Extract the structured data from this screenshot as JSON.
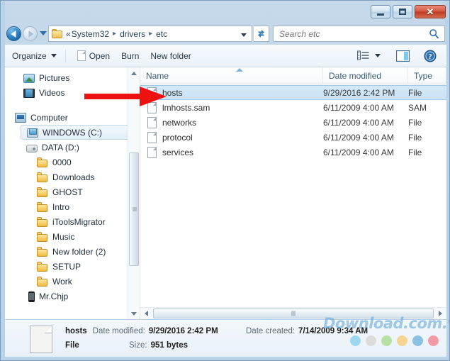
{
  "window": {
    "controls": {
      "minimize_label": "Minimize",
      "maximize_label": "Maximize",
      "close_label": "✕"
    }
  },
  "address_bar": {
    "back_label": "Back",
    "forward_label": "Forward",
    "history_label": "Recent pages",
    "prev_crumb": "«",
    "crumbs": [
      "System32",
      "drivers",
      "etc"
    ],
    "separator": "▸",
    "dropdown_label": "Previous locations",
    "refresh_label": "Refresh"
  },
  "search": {
    "placeholder": "Search etc",
    "value": "",
    "icon": "search-icon"
  },
  "toolbar": {
    "organize_label": "Organize",
    "open_label": "Open",
    "burn_label": "Burn",
    "new_folder_label": "New folder",
    "view_label": "Change your view",
    "preview_label": "Show the preview pane",
    "help_label": "Get help"
  },
  "nav_pane": {
    "items": [
      {
        "label": "Pictures",
        "icon": "pictures-icon",
        "indent": 26,
        "selected": false
      },
      {
        "label": "Videos",
        "icon": "videos-icon",
        "indent": 26,
        "selected": false
      },
      {
        "label": "Computer",
        "icon": "computer-icon",
        "indent": 14,
        "selected": false
      },
      {
        "label": "WINDOWS (C:)",
        "icon": "drive-c-icon",
        "indent": 30,
        "selected": true
      },
      {
        "label": "DATA (D:)",
        "icon": "drive-d-icon",
        "indent": 30,
        "selected": false
      },
      {
        "label": "0000",
        "icon": "folder-icon",
        "indent": 45,
        "selected": false
      },
      {
        "label": "Downloads",
        "icon": "folder-icon",
        "indent": 45,
        "selected": false
      },
      {
        "label": "GHOST",
        "icon": "folder-icon",
        "indent": 45,
        "selected": false
      },
      {
        "label": "Intro",
        "icon": "folder-icon",
        "indent": 45,
        "selected": false
      },
      {
        "label": "iToolsMigrator",
        "icon": "folder-icon",
        "indent": 45,
        "selected": false
      },
      {
        "label": "Music",
        "icon": "folder-icon",
        "indent": 45,
        "selected": false
      },
      {
        "label": "New folder (2)",
        "icon": "folder-icon",
        "indent": 45,
        "selected": false
      },
      {
        "label": "SETUP",
        "icon": "folder-icon",
        "indent": 45,
        "selected": false
      },
      {
        "label": "Work",
        "icon": "folder-icon",
        "indent": 45,
        "selected": false
      },
      {
        "label": "Mr.Chjp",
        "icon": "phone-icon",
        "indent": 30,
        "selected": false
      }
    ]
  },
  "file_list": {
    "columns": [
      {
        "key": "name",
        "label": "Name",
        "sorted": true,
        "sort_direction": "asc"
      },
      {
        "key": "date",
        "label": "Date modified",
        "sorted": false
      },
      {
        "key": "type",
        "label": "Type",
        "sorted": false
      }
    ],
    "rows": [
      {
        "name": "hosts",
        "date": "9/29/2016 2:42 PM",
        "type": "File",
        "selected": true
      },
      {
        "name": "lmhosts.sam",
        "date": "6/11/2009 4:00 AM",
        "type": "SAM",
        "selected": false
      },
      {
        "name": "networks",
        "date": "6/11/2009 4:00 AM",
        "type": "File",
        "selected": false
      },
      {
        "name": "protocol",
        "date": "6/11/2009 4:00 AM",
        "type": "File",
        "selected": false
      },
      {
        "name": "services",
        "date": "6/11/2009 4:00 AM",
        "type": "File",
        "selected": false
      }
    ]
  },
  "details_pane": {
    "file_name": "hosts",
    "file_kind": "File",
    "date_modified_label": "Date modified:",
    "date_modified_value": "9/29/2016 2:42 PM",
    "size_label": "Size:",
    "size_value": "951 bytes",
    "date_created_label": "Date created:",
    "date_created_value": "7/14/2009 9:34 AM"
  },
  "annotation": {
    "arrow_color": "#ee1111",
    "arrow_target": "hosts file row"
  },
  "watermark": {
    "text": "Download.com.vn",
    "dot_colors": [
      "#9fd8ee",
      "#dcdcdc",
      "#b9e0a4",
      "#f5d592",
      "#8cc0e0",
      "#f09ba6"
    ]
  },
  "colors": {
    "frame": "#b9d2e6",
    "selection": "#cae3f5",
    "accent": "#2e6da4"
  }
}
